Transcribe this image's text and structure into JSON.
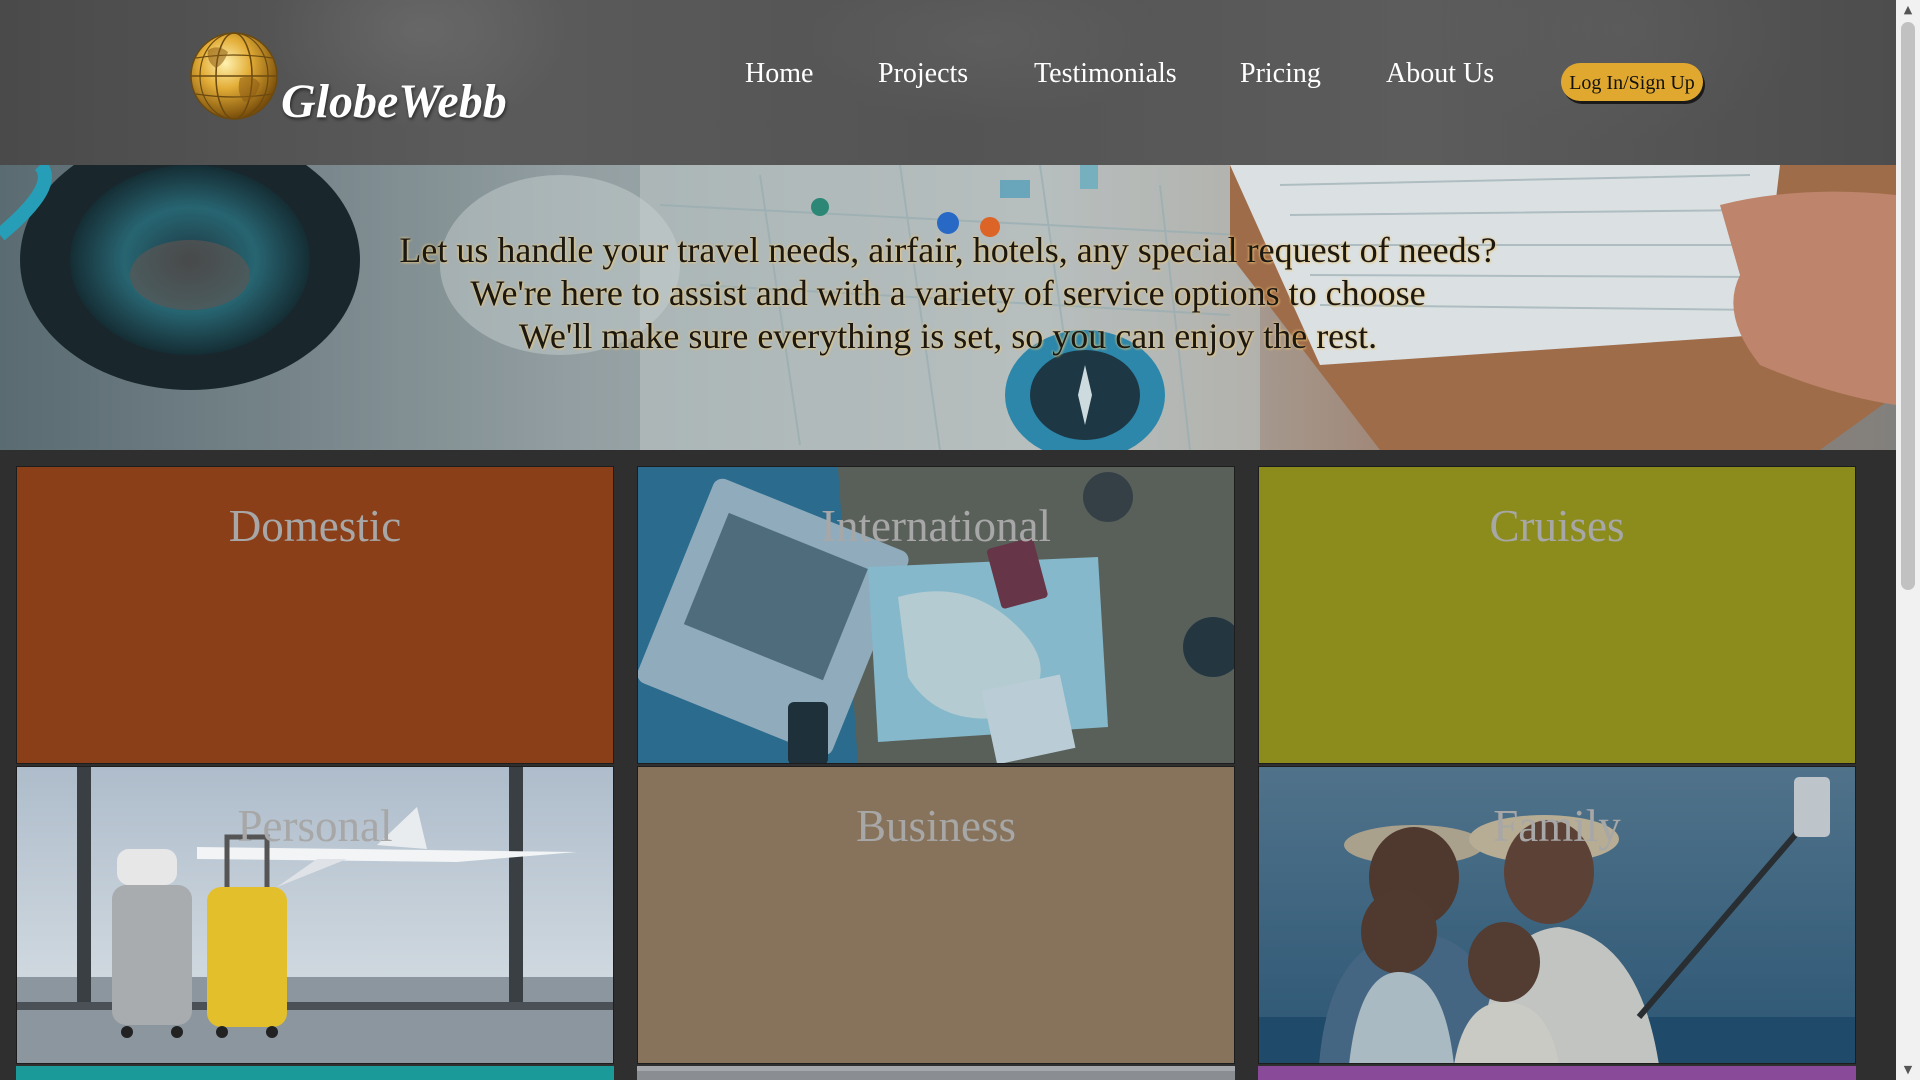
{
  "brand": {
    "name": "GlobeWebb",
    "logo_icon": "golden-globe-icon"
  },
  "nav": {
    "items": [
      {
        "label": "Home"
      },
      {
        "label": "Projects"
      },
      {
        "label": "Testimonials"
      },
      {
        "label": "Pricing"
      },
      {
        "label": "About Us"
      }
    ],
    "login_label": "Log In/Sign Up"
  },
  "hero": {
    "lines": [
      "Let us handle your travel needs, airfair, hotels, any special request of needs?",
      "We're here to assist and with a variety of service options to choose",
      "We'll make sure everything is set, so you can enjoy the rest."
    ]
  },
  "tiles": [
    {
      "title": "Domestic",
      "color": "#8b3f18"
    },
    {
      "title": "International",
      "color": "#2f6f8f"
    },
    {
      "title": "Cruises",
      "color": "#8c8c1c"
    },
    {
      "title": "Personal",
      "color": "#8fa3b4"
    },
    {
      "title": "Business",
      "color": "#87735b"
    },
    {
      "title": "Family",
      "color": "#5c7e95"
    }
  ],
  "colors": {
    "accent": "#e0a82f",
    "page_background": "#2f2f2f",
    "teal_strip": "#1a9a98",
    "purple_strip": "#8a4a9a"
  }
}
